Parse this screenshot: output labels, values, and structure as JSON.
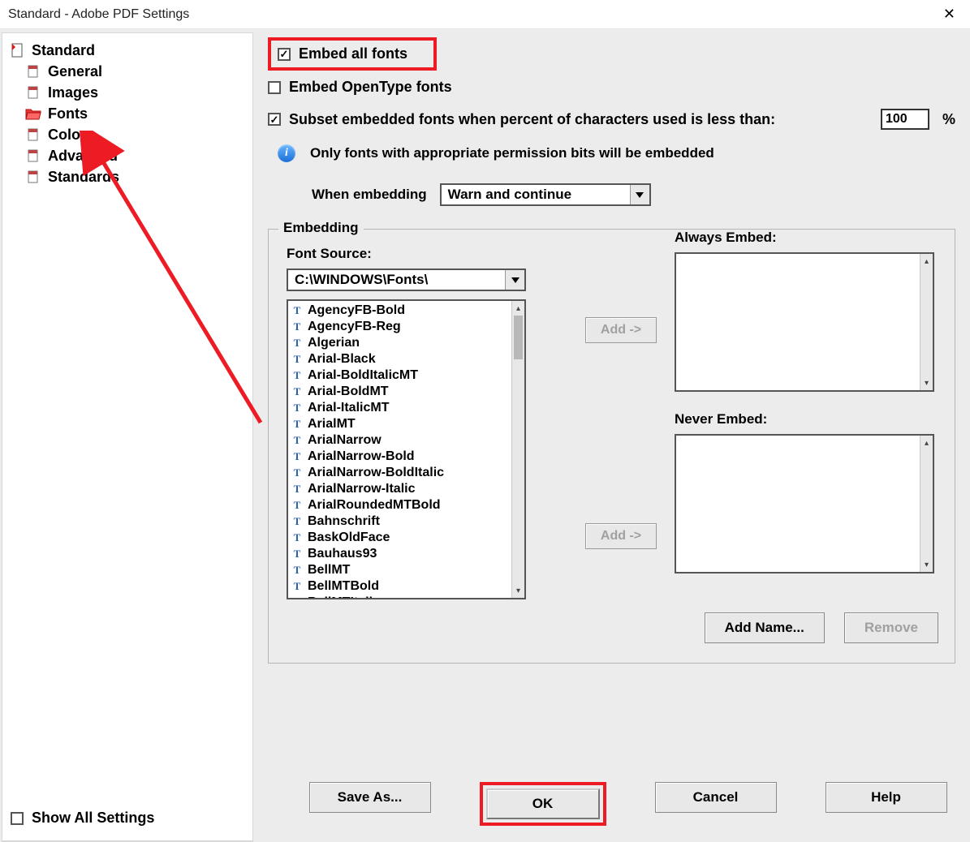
{
  "window": {
    "title": "Standard - Adobe PDF Settings"
  },
  "sidebar": {
    "root": "Standard",
    "items": [
      "General",
      "Images",
      "Fonts",
      "Color",
      "Advanced",
      "Standards"
    ],
    "show_all": "Show All Settings"
  },
  "main": {
    "embed_all": "Embed all fonts",
    "embed_ot": "Embed OpenType fonts",
    "subset": "Subset embedded fonts when percent of characters used is less than:",
    "pct": "100",
    "info": "Only fonts with appropriate permission bits will be embedded",
    "when_label": "When embedding",
    "when_value": "Warn and continue",
    "fieldset": "Embedding",
    "font_source_label": "Font Source:",
    "font_source_value": "C:\\WINDOWS\\Fonts\\",
    "fonts": [
      "AgencyFB-Bold",
      "AgencyFB-Reg",
      "Algerian",
      "Arial-Black",
      "Arial-BoldItalicMT",
      "Arial-BoldMT",
      "Arial-ItalicMT",
      "ArialMT",
      "ArialNarrow",
      "ArialNarrow-Bold",
      "ArialNarrow-BoldItalic",
      "ArialNarrow-Italic",
      "ArialRoundedMTBold",
      "Bahnschrift",
      "BaskOldFace",
      "Bauhaus93",
      "BellMT",
      "BellMTBold",
      "BellMTItalic"
    ],
    "add_btn": "Add ->",
    "always_label": "Always Embed:",
    "never_label": "Never Embed:",
    "add_name": "Add Name...",
    "remove": "Remove"
  },
  "buttons": {
    "save_as": "Save As...",
    "ok": "OK",
    "cancel": "Cancel",
    "help": "Help"
  }
}
